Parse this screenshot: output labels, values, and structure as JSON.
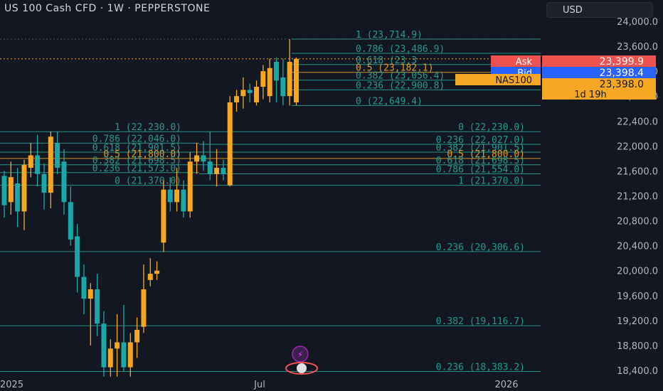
{
  "header": {
    "title": "US 100 Cash CFD · 1W · PEPPERSTONE",
    "currency": "USD"
  },
  "colors": {
    "up": "#f5a623",
    "down": "#1aa7a7",
    "fib": "#26a69a",
    "fibHighlight": "#f5a623",
    "bg": "#131722",
    "axisText": "#b2b5be",
    "ask": "#ef5350",
    "bid": "#2962ff",
    "instr": "#f5a623"
  },
  "chart_data": {
    "type": "candlestick",
    "title": "US 100 Cash CFD · 1W · PEPPERSTONE",
    "ylim": [
      18300,
      24300
    ],
    "y_ticks": [
      "24,000.0",
      "23,600.0",
      "23,200.0",
      "22,800.0",
      "22,400.0",
      "22,000.0",
      "21,600.0",
      "21,200.0",
      "20,800.0",
      "20,400.0",
      "20,000.0",
      "19,600.0",
      "19,200.0",
      "18,800.0",
      "18,400.0"
    ],
    "y_tick_values": [
      24000,
      23600,
      23200,
      22800,
      22400,
      22000,
      21600,
      21200,
      20800,
      20400,
      20000,
      19600,
      19200,
      18800,
      18400
    ],
    "x_labels": [
      "2025",
      "Jul",
      "2026"
    ],
    "candles": [
      {
        "o": 21520,
        "h": 21600,
        "l": 20850,
        "c": 21050
      },
      {
        "o": 21100,
        "h": 21750,
        "l": 20900,
        "c": 21500
      },
      {
        "o": 21400,
        "h": 21650,
        "l": 20700,
        "c": 20950
      },
      {
        "o": 20950,
        "h": 21780,
        "l": 20650,
        "c": 21700
      },
      {
        "o": 21650,
        "h": 22050,
        "l": 21500,
        "c": 21850
      },
      {
        "o": 21850,
        "h": 22180,
        "l": 21350,
        "c": 21550
      },
      {
        "o": 21550,
        "h": 21720,
        "l": 20980,
        "c": 21250
      },
      {
        "o": 21250,
        "h": 22230,
        "l": 21000,
        "c": 22150
      },
      {
        "o": 22050,
        "h": 22230,
        "l": 21550,
        "c": 21650
      },
      {
        "o": 21750,
        "h": 21950,
        "l": 20900,
        "c": 21100
      },
      {
        "o": 21100,
        "h": 21350,
        "l": 20400,
        "c": 20500
      },
      {
        "o": 20550,
        "h": 20750,
        "l": 19650,
        "c": 19900
      },
      {
        "o": 19900,
        "h": 20100,
        "l": 19300,
        "c": 19550
      },
      {
        "o": 19550,
        "h": 19800,
        "l": 18800,
        "c": 19700
      },
      {
        "o": 19700,
        "h": 19950,
        "l": 18950,
        "c": 19150
      },
      {
        "o": 19150,
        "h": 19350,
        "l": 18300,
        "c": 18450
      },
      {
        "o": 18450,
        "h": 18900,
        "l": 18300,
        "c": 18750
      },
      {
        "o": 18750,
        "h": 19300,
        "l": 18300,
        "c": 18850
      },
      {
        "o": 18850,
        "h": 19450,
        "l": 18380,
        "c": 18450
      },
      {
        "o": 18450,
        "h": 19000,
        "l": 18300,
        "c": 18850
      },
      {
        "o": 18850,
        "h": 19250,
        "l": 18600,
        "c": 19050
      },
      {
        "o": 19100,
        "h": 20100,
        "l": 19000,
        "c": 19700
      },
      {
        "o": 19850,
        "h": 20200,
        "l": 19750,
        "c": 19950
      },
      {
        "o": 19950,
        "h": 20150,
        "l": 19850,
        "c": 20000
      },
      {
        "o": 20450,
        "h": 21450,
        "l": 20300,
        "c": 21300
      },
      {
        "o": 21300,
        "h": 21500,
        "l": 20950,
        "c": 21100
      },
      {
        "o": 21100,
        "h": 21650,
        "l": 20950,
        "c": 21300
      },
      {
        "o": 21300,
        "h": 21450,
        "l": 20850,
        "c": 20950
      },
      {
        "o": 20950,
        "h": 21900,
        "l": 20850,
        "c": 21750
      },
      {
        "o": 21750,
        "h": 22050,
        "l": 21550,
        "c": 21850
      },
      {
        "o": 21850,
        "h": 22080,
        "l": 21600,
        "c": 21750
      },
      {
        "o": 21750,
        "h": 22230,
        "l": 21450,
        "c": 21550
      },
      {
        "o": 21550,
        "h": 21950,
        "l": 21350,
        "c": 21650
      },
      {
        "o": 21650,
        "h": 21780,
        "l": 21450,
        "c": 21550
      },
      {
        "o": 21370,
        "h": 22800,
        "l": 21350,
        "c": 22700
      },
      {
        "o": 22700,
        "h": 22900,
        "l": 22550,
        "c": 22800
      },
      {
        "o": 22800,
        "h": 23100,
        "l": 22600,
        "c": 22900
      },
      {
        "o": 22900,
        "h": 23000,
        "l": 22700,
        "c": 22850
      },
      {
        "o": 22700,
        "h": 23050,
        "l": 22650,
        "c": 22950
      },
      {
        "o": 22950,
        "h": 23300,
        "l": 22750,
        "c": 23200
      },
      {
        "o": 22800,
        "h": 23400,
        "l": 22700,
        "c": 23250
      },
      {
        "o": 23350,
        "h": 23420,
        "l": 22700,
        "c": 23050
      },
      {
        "o": 23100,
        "h": 23400,
        "l": 22650,
        "c": 22800
      },
      {
        "o": 22800,
        "h": 23714.9,
        "l": 22649.4,
        "c": 23350
      },
      {
        "o": 22700,
        "h": 23420,
        "l": 22650,
        "c": 23398
      }
    ],
    "fib_levels": [
      {
        "label": "1 (23,714.9)",
        "price": 23714.9,
        "group": "A",
        "x0_label": "495"
      },
      {
        "label": "0.786 (23,486.9)",
        "price": 23486.9,
        "group": "A"
      },
      {
        "label": "0.618 (23,3",
        "price": 23307,
        "group": "A"
      },
      {
        "label": "0.5 (23,182.1)",
        "price": 23182.1,
        "group": "A",
        "hl": true
      },
      {
        "label": "0.382 (23,056.4)",
        "price": 23056.4,
        "group": "A"
      },
      {
        "label": "0.236 (22,900.8)",
        "price": 22900.8,
        "group": "A"
      },
      {
        "label": "0 (22,649.4)",
        "price": 22649.4,
        "group": "A"
      },
      {
        "label": "1 (22,230.0)",
        "price": 22230,
        "group": "B"
      },
      {
        "label": "0.786 (22,046.0)",
        "price": 22046,
        "group": "B"
      },
      {
        "label": "0.618 (21,901.5)",
        "price": 21901.5,
        "group": "B"
      },
      {
        "label": "0.5 (21,800.0)",
        "price": 21800,
        "group": "B",
        "hl": true
      },
      {
        "label": "0.382 (21,698.5)",
        "price": 21698.5,
        "group": "B"
      },
      {
        "label": "0.236 (21,573.0)",
        "price": 21573,
        "group": "B"
      },
      {
        "label": "0 (21,370.0)",
        "price": 21370,
        "group": "B"
      },
      {
        "label": "0 (22,230.0)",
        "price": 22230,
        "group": "C"
      },
      {
        "label": "0.236 (22,027.0)",
        "price": 22027,
        "group": "C"
      },
      {
        "label": "0.382 (21,901.5)",
        "price": 21901.5,
        "group": "C"
      },
      {
        "label": "0.5 (21,800.0)",
        "price": 21800,
        "group": "C",
        "hl": true
      },
      {
        "label": "0.618 (21,698.5)",
        "price": 21698.5,
        "group": "C"
      },
      {
        "label": "0.786 (21,554.0)",
        "price": 21554,
        "group": "C"
      },
      {
        "label": "1 (21,370.0)",
        "price": 21370,
        "group": "C"
      },
      {
        "label": "0.236 (20,306.6)",
        "price": 20306.6,
        "group": "D"
      },
      {
        "label": "0.382 (19,116.7)",
        "price": 19116.7,
        "group": "D"
      },
      {
        "label": "0.236 (18,383.2)",
        "price": 18383.2,
        "group": "D"
      }
    ],
    "price_labels": [
      {
        "tag": "Ask",
        "value": "23,399.9",
        "price": 23399.9
      },
      {
        "tag": "Bid",
        "value": "23,398.4",
        "price": 23398.4
      },
      {
        "tag": "NAS100",
        "value": "23,398.0",
        "price": 23398.0,
        "sub": "1d 19h"
      }
    ]
  }
}
